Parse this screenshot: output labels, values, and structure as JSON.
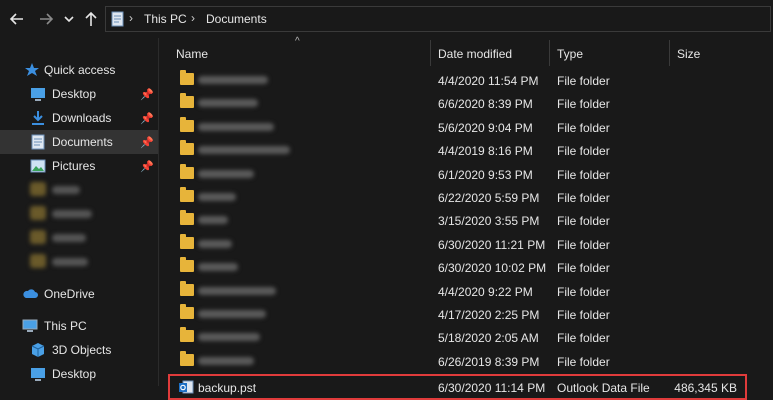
{
  "address": {
    "crumbs": [
      "This PC",
      "Documents"
    ]
  },
  "nav": {
    "quick_access": "Quick access",
    "items": [
      {
        "label": "Desktop"
      },
      {
        "label": "Downloads"
      },
      {
        "label": "Documents"
      },
      {
        "label": "Pictures"
      }
    ],
    "onedrive": "OneDrive",
    "this_pc": "This PC",
    "pc_items": [
      {
        "label": "3D Objects"
      },
      {
        "label": "Desktop"
      }
    ]
  },
  "columns": {
    "name": "Name",
    "date": "Date modified",
    "type": "Type",
    "size": "Size"
  },
  "files": [
    {
      "date": "4/4/2020 11:54 PM",
      "type": "File folder"
    },
    {
      "date": "6/6/2020 8:39 PM",
      "type": "File folder"
    },
    {
      "date": "5/6/2020 9:04 PM",
      "type": "File folder"
    },
    {
      "date": "4/4/2019 8:16 PM",
      "type": "File folder"
    },
    {
      "date": "6/1/2020 9:53 PM",
      "type": "File folder"
    },
    {
      "date": "6/22/2020 5:59 PM",
      "type": "File folder"
    },
    {
      "date": "3/15/2020 3:55 PM",
      "type": "File folder"
    },
    {
      "date": "6/30/2020 11:21 PM",
      "type": "File folder"
    },
    {
      "date": "6/30/2020 10:02 PM",
      "type": "File folder"
    },
    {
      "date": "4/4/2020 9:22 PM",
      "type": "File folder"
    },
    {
      "date": "4/17/2020 2:25 PM",
      "type": "File folder"
    },
    {
      "date": "5/18/2020 2:05 AM",
      "type": "File folder"
    },
    {
      "date": "6/26/2019 8:39 PM",
      "type": "File folder"
    }
  ],
  "pst": {
    "name": "backup.pst",
    "date": "6/30/2020 11:14 PM",
    "type": "Outlook Data File",
    "size": "486,345 KB"
  },
  "colors": {
    "background": "#191919",
    "highlight": "#e03b3b",
    "folder": "#e7b43a",
    "selected_nav": "#333333"
  }
}
